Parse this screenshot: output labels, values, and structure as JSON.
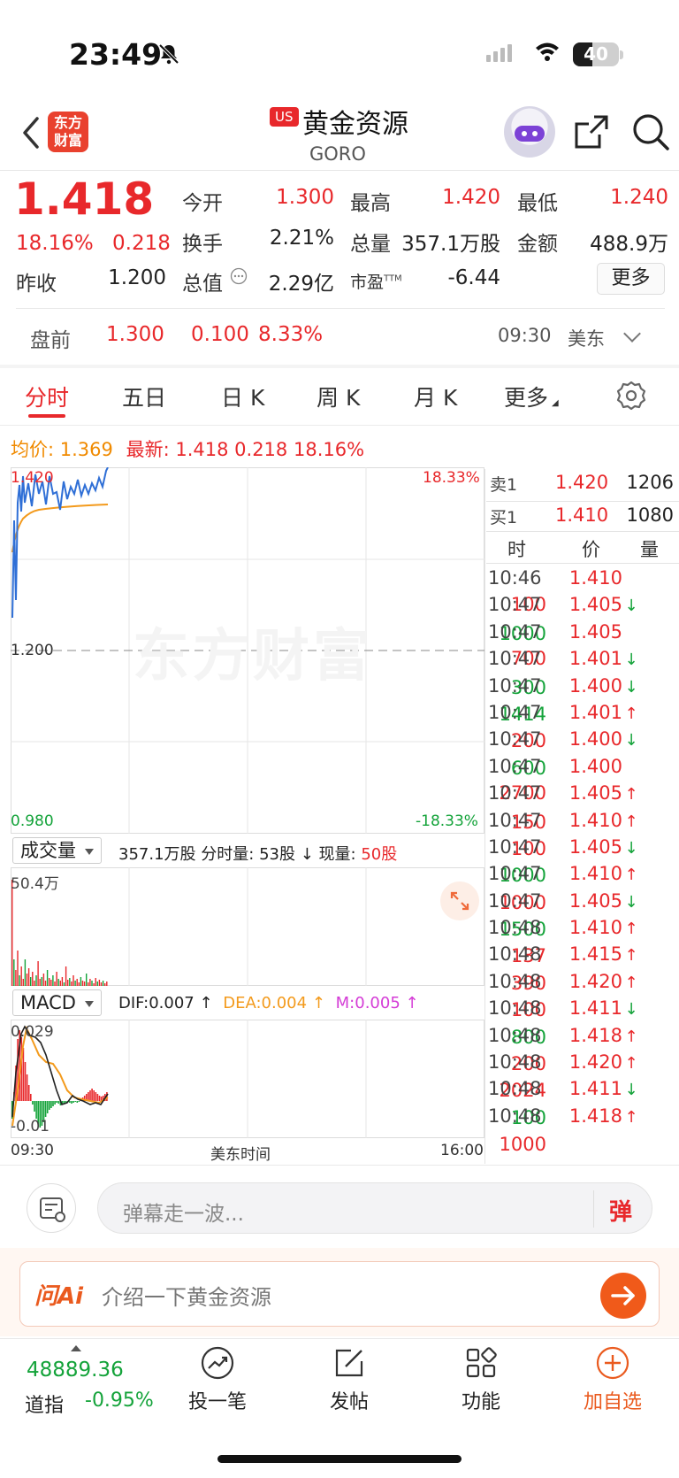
{
  "status_bar": {
    "time": "23:49",
    "battery": "40"
  },
  "header": {
    "logo_text": "东方财富",
    "market_badge": "US",
    "stock_name": "黄金资源",
    "stock_code": "GORO"
  },
  "quote": {
    "price": "1.418",
    "change_pct": "18.16%",
    "change": "0.218",
    "fields": [
      {
        "label": "今开",
        "value": "1.300",
        "color": "red"
      },
      {
        "label": "最高",
        "value": "1.420",
        "color": "red"
      },
      {
        "label": "最低",
        "value": "1.240",
        "color": "red"
      },
      {
        "label": "换手",
        "value": "2.21%",
        "color": "black"
      },
      {
        "label": "总量",
        "value": "357.1万股",
        "color": "black"
      },
      {
        "label": "金额",
        "value": "488.9万",
        "color": "black"
      },
      {
        "label": "昨收",
        "value": "1.200",
        "color": "black"
      },
      {
        "label": "总值",
        "value": "2.29亿",
        "color": "black"
      },
      {
        "label": "市盈",
        "value": "-6.44",
        "color": "black"
      }
    ],
    "pe_sup": "TTM",
    "more_label": "更多"
  },
  "premarket": {
    "label": "盘前",
    "price": "1.300",
    "change": "0.100",
    "pct": "8.33%",
    "time": "09:30",
    "zone": "美东"
  },
  "tabs": [
    {
      "label": "分时",
      "active": true
    },
    {
      "label": "五日",
      "active": false
    },
    {
      "label": "日 K",
      "active": false
    },
    {
      "label": "周 K",
      "active": false
    },
    {
      "label": "月 K",
      "active": false
    },
    {
      "label": "更多",
      "active": false
    }
  ],
  "avg_line": {
    "avg_label": "均价:",
    "avg_value": "1.369",
    "latest_label": "最新:",
    "latest_value": "1.418",
    "latest_change": "0.218",
    "latest_pct": "18.16%"
  },
  "intraday_chart": {
    "top_price": "1.420",
    "top_pct": "18.33%",
    "mid_price": "1.200",
    "bottom_price": "0.980",
    "bottom_pct": "-18.33%",
    "watermark": "东方财富",
    "colors": {
      "price": "#2f6fd6",
      "avg": "#f39a1c",
      "up": "#e8282b",
      "down": "#14a33a"
    }
  },
  "volume_panel": {
    "selector": "成交量",
    "total": "357.1万股",
    "minute_label": "分时量:",
    "minute_value": "53股",
    "arrow": "↓",
    "current_label": "现量:",
    "current_value": "50股",
    "max_label": "50.4万"
  },
  "macd_panel": {
    "selector": "MACD",
    "dif": "DIF:0.007 ↑",
    "dea": "DEA:0.004 ↑",
    "m": "M:0.005 ↑",
    "top_label": "0.029",
    "bottom_label": "-0.01"
  },
  "time_axis": {
    "start": "09:30",
    "middle": "美东时间",
    "end": "16:00"
  },
  "order_book": [
    {
      "label": "卖1",
      "price": "1.420",
      "volume": "1206"
    },
    {
      "label": "买1",
      "price": "1.410",
      "volume": "1080"
    }
  ],
  "trades_header": {
    "time": "时",
    "price": "价",
    "volume": "量"
  },
  "trades": [
    {
      "time": "10:46",
      "price": "1.410",
      "arrow": "",
      "volume": "100",
      "dir": "up"
    },
    {
      "time": "10:47",
      "price": "1.405",
      "arrow": "↓",
      "volume": "1000",
      "dir": "down"
    },
    {
      "time": "10:47",
      "price": "1.405",
      "arrow": "",
      "volume": "700",
      "dir": "up"
    },
    {
      "time": "10:47",
      "price": "1.401",
      "arrow": "↓",
      "volume": "300",
      "dir": "down"
    },
    {
      "time": "10:47",
      "price": "1.400",
      "arrow": "↓",
      "volume": "1414",
      "dir": "down"
    },
    {
      "time": "10:47",
      "price": "1.401",
      "arrow": "↑",
      "volume": "200",
      "dir": "up"
    },
    {
      "time": "10:47",
      "price": "1.400",
      "arrow": "↓",
      "volume": "600",
      "dir": "down"
    },
    {
      "time": "10:47",
      "price": "1.400",
      "arrow": "",
      "volume": "2700",
      "dir": "up"
    },
    {
      "time": "10:47",
      "price": "1.405",
      "arrow": "↑",
      "volume": "150",
      "dir": "up"
    },
    {
      "time": "10:47",
      "price": "1.410",
      "arrow": "↑",
      "volume": "100",
      "dir": "up"
    },
    {
      "time": "10:47",
      "price": "1.405",
      "arrow": "↓",
      "volume": "1000",
      "dir": "down"
    },
    {
      "time": "10:47",
      "price": "1.410",
      "arrow": "↑",
      "volume": "1000",
      "dir": "up"
    },
    {
      "time": "10:47",
      "price": "1.405",
      "arrow": "↓",
      "volume": "1500",
      "dir": "down"
    },
    {
      "time": "10:48",
      "price": "1.410",
      "arrow": "↑",
      "volume": "137",
      "dir": "up"
    },
    {
      "time": "10:48",
      "price": "1.415",
      "arrow": "↑",
      "volume": "390",
      "dir": "up"
    },
    {
      "time": "10:48",
      "price": "1.420",
      "arrow": "↑",
      "volume": "100",
      "dir": "up"
    },
    {
      "time": "10:48",
      "price": "1.411",
      "arrow": "↓",
      "volume": "800",
      "dir": "down"
    },
    {
      "time": "10:48",
      "price": "1.418",
      "arrow": "↑",
      "volume": "200",
      "dir": "up"
    },
    {
      "time": "10:48",
      "price": "1.420",
      "arrow": "↑",
      "volume": "2024",
      "dir": "up"
    },
    {
      "time": "10:48",
      "price": "1.411",
      "arrow": "↓",
      "volume": "100",
      "dir": "down"
    },
    {
      "time": "10:48",
      "price": "1.418",
      "arrow": "↑",
      "volume": "1000",
      "dir": "up"
    }
  ],
  "danmu": {
    "placeholder": "弹幕走一波...",
    "button": "弹"
  },
  "ai_bar": {
    "logo": "问Ai",
    "placeholder": "介绍一下黄金资源"
  },
  "bottom_nav": {
    "index_value": "48889.36",
    "index_name": "道指",
    "index_pct": "-0.95%",
    "items": [
      {
        "label": "投一笔",
        "icon": "trend-icon"
      },
      {
        "label": "发帖",
        "icon": "edit-icon"
      },
      {
        "label": "功能",
        "icon": "grid-icon"
      },
      {
        "label": "加自选",
        "icon": "plus-circle-icon"
      }
    ]
  }
}
